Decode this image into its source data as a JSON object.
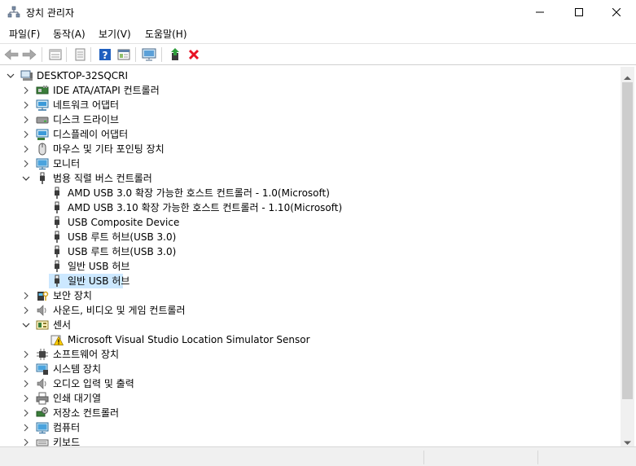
{
  "window": {
    "title": "장치 관리자",
    "minimize_glyph": "minimize-icon",
    "maximize_glyph": "maximize-icon",
    "close_glyph": "close-icon"
  },
  "menu": [
    {
      "label": "파일(F)"
    },
    {
      "label": "동작(A)"
    },
    {
      "label": "보기(V)"
    },
    {
      "label": "도움말(H)"
    }
  ],
  "toolbar": [
    "back-icon",
    "forward-icon",
    "properties-icon",
    "driver-icon",
    "help-icon",
    "action-icon",
    "monitor-icon",
    "update-driver-icon",
    "uninstall-icon"
  ],
  "tree": {
    "root": "DESKTOP-32SQCRI",
    "items": [
      {
        "label": "IDE ATA/ATAPI 컨트롤러",
        "icon": "ide-controller-icon",
        "level": 1,
        "expander": "collapsed"
      },
      {
        "label": "네트워크 어댑터",
        "icon": "network-adapter-icon",
        "level": 1,
        "expander": "collapsed"
      },
      {
        "label": "디스크 드라이브",
        "icon": "disk-drive-icon",
        "level": 1,
        "expander": "collapsed"
      },
      {
        "label": "디스플레이 어댑터",
        "icon": "display-adapter-icon",
        "level": 1,
        "expander": "collapsed"
      },
      {
        "label": "마우스 및 기타 포인팅 장치",
        "icon": "mouse-icon",
        "level": 1,
        "expander": "collapsed"
      },
      {
        "label": "모니터",
        "icon": "monitor-icon",
        "level": 1,
        "expander": "collapsed"
      },
      {
        "label": "범용 직렬 버스 컨트롤러",
        "icon": "usb-icon",
        "level": 1,
        "expander": "expanded"
      },
      {
        "label": "AMD USB 3.0 확장 가능한 호스트 컨트롤러 - 1.0(Microsoft)",
        "icon": "usb-icon",
        "level": 2
      },
      {
        "label": "AMD USB 3.10 확장 가능한 호스트 컨트롤러 - 1.10(Microsoft)",
        "icon": "usb-icon",
        "level": 2
      },
      {
        "label": "USB Composite Device",
        "icon": "usb-icon",
        "level": 2
      },
      {
        "label": "USB 루트 허브(USB 3.0)",
        "icon": "usb-icon",
        "level": 2
      },
      {
        "label": "USB 루트 허브(USB 3.0)",
        "icon": "usb-icon",
        "level": 2
      },
      {
        "label": "일반 USB 허브",
        "icon": "usb-icon",
        "level": 2
      },
      {
        "label": "일반 USB 허브",
        "icon": "usb-icon",
        "level": 2,
        "selected": true
      },
      {
        "label": "보안 장치",
        "icon": "security-device-icon",
        "level": 1,
        "expander": "collapsed"
      },
      {
        "label": "사운드, 비디오 및 게임 컨트롤러",
        "icon": "speaker-icon",
        "level": 1,
        "expander": "collapsed"
      },
      {
        "label": "센서",
        "icon": "sensor-icon",
        "level": 1,
        "expander": "expanded"
      },
      {
        "label": "Microsoft Visual Studio Location Simulator Sensor",
        "icon": "warning-icon",
        "level": 2
      },
      {
        "label": "소프트웨어 장치",
        "icon": "software-device-icon",
        "level": 1,
        "expander": "collapsed"
      },
      {
        "label": "시스템 장치",
        "icon": "system-device-icon",
        "level": 1,
        "expander": "collapsed"
      },
      {
        "label": "오디오 입력 및 출력",
        "icon": "speaker-icon",
        "level": 1,
        "expander": "collapsed"
      },
      {
        "label": "인쇄 대기열",
        "icon": "printer-icon",
        "level": 1,
        "expander": "collapsed"
      },
      {
        "label": "저장소 컨트롤러",
        "icon": "storage-controller-icon",
        "level": 1,
        "expander": "collapsed"
      },
      {
        "label": "컴퓨터",
        "icon": "computer-icon",
        "level": 1,
        "expander": "collapsed"
      },
      {
        "label": "키보드",
        "icon": "keyboard-icon",
        "level": 1,
        "expander": "collapsed"
      }
    ]
  },
  "colors": {
    "selection": "#cce8ff",
    "uninstall_red": "#e81123",
    "help_blue": "#1f5fbf"
  }
}
